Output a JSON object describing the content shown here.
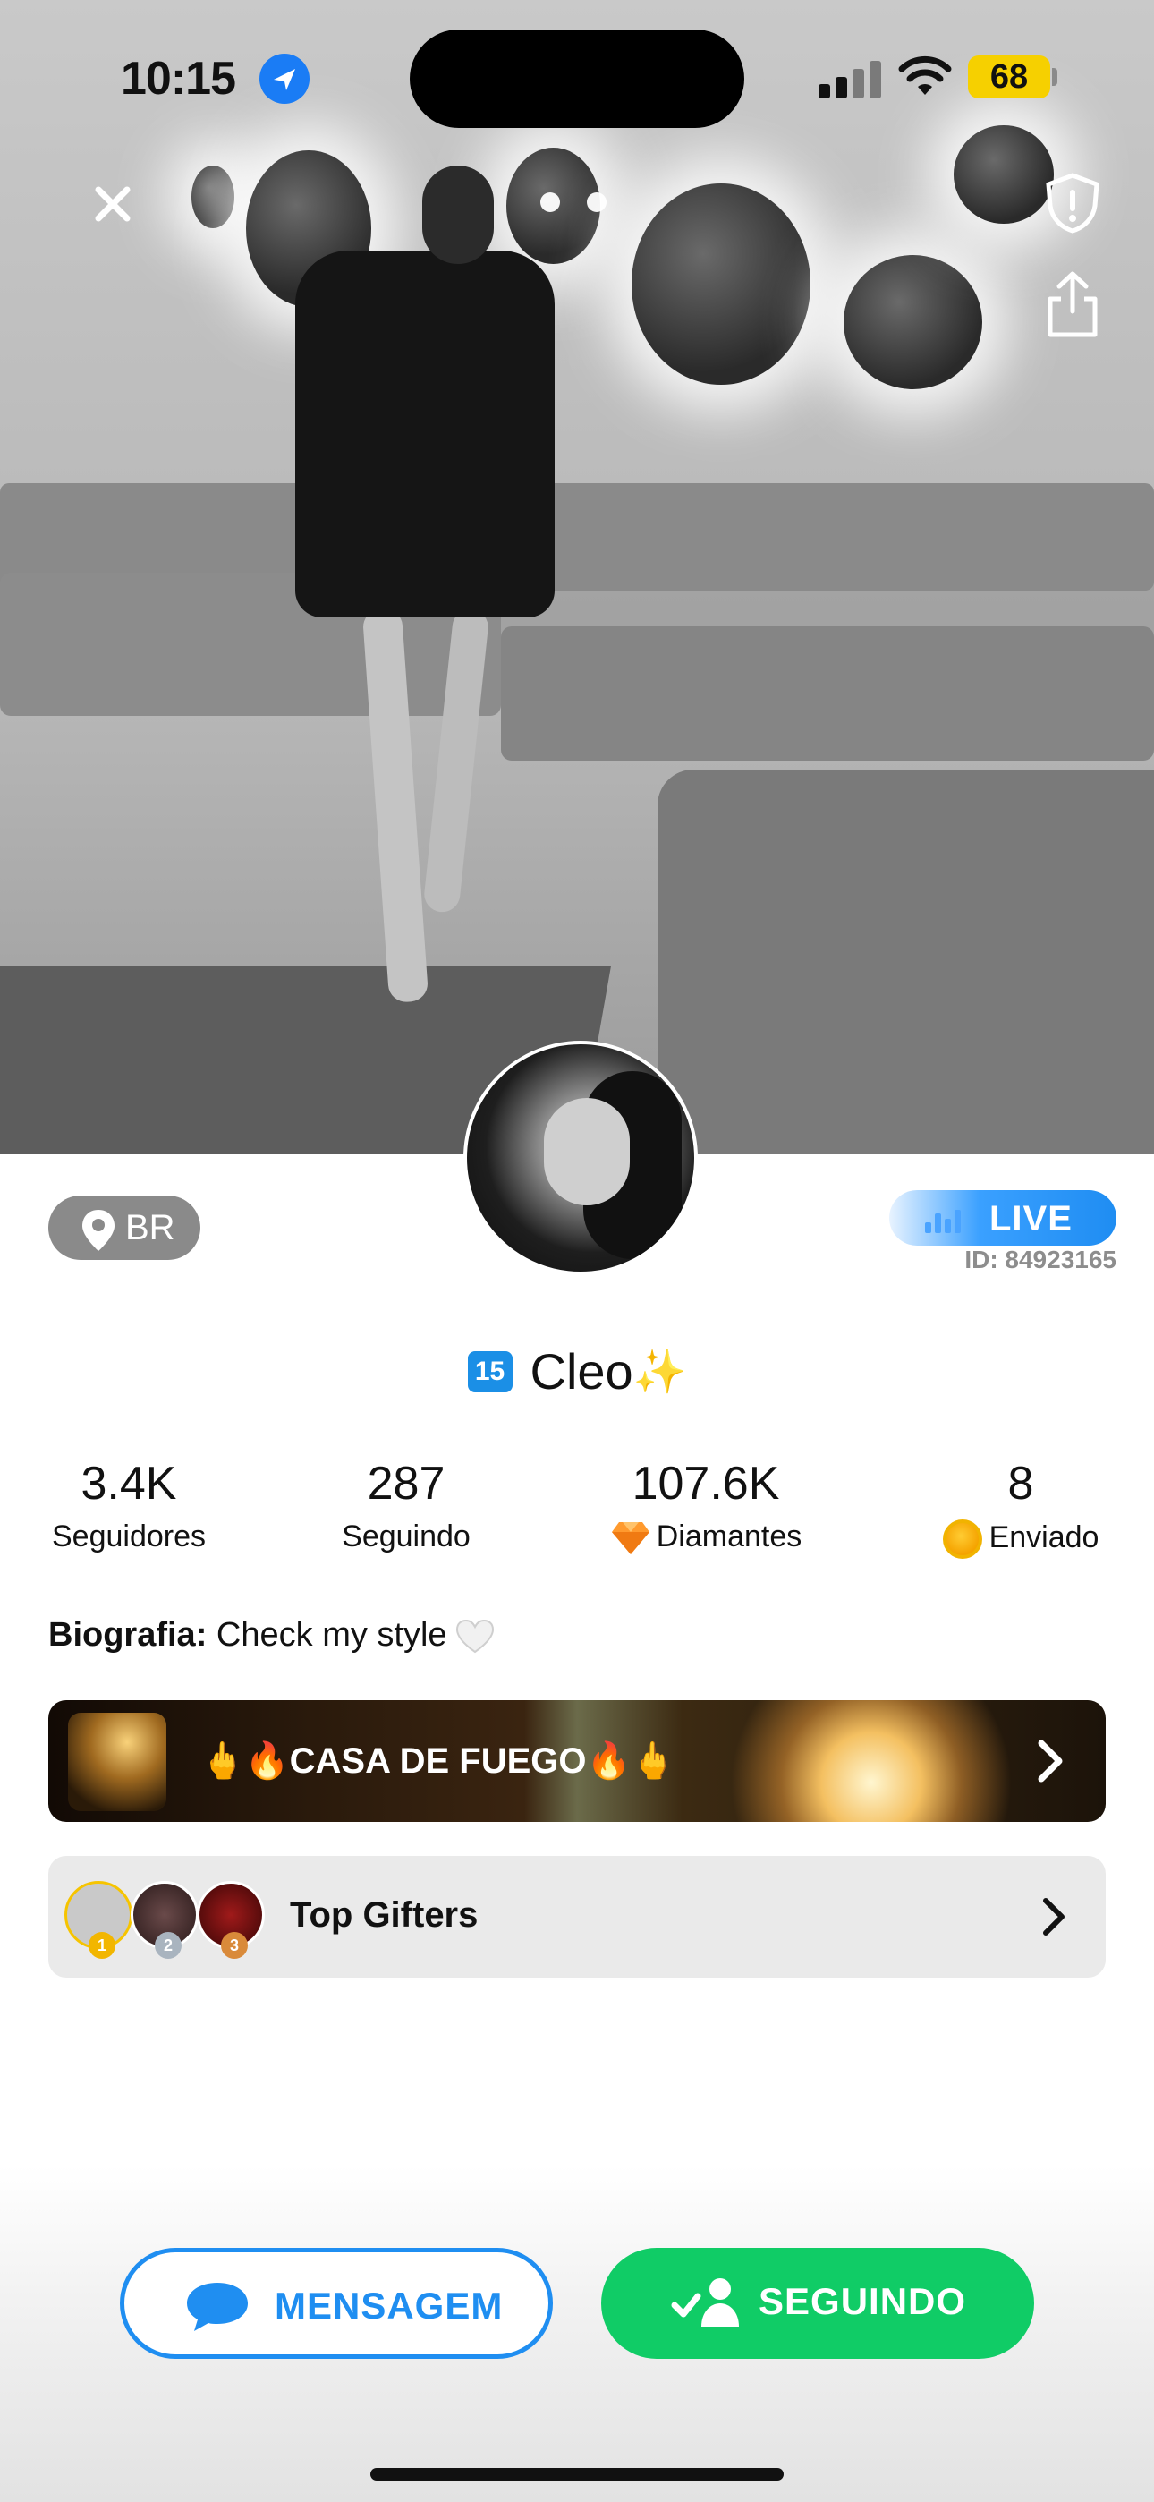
{
  "status_bar": {
    "time": "10:15",
    "battery": "68"
  },
  "profile": {
    "location": "BR",
    "live_label": "LIVE",
    "id_text": "ID: 84923165",
    "level": "15",
    "name": "Cleo",
    "name_emoji": "✨"
  },
  "stats": [
    {
      "value": "3.4K",
      "label": "Seguidores"
    },
    {
      "value": "287",
      "label": "Seguindo"
    },
    {
      "value": "107.6K",
      "label": "Diamantes",
      "icon": "diamond-icon"
    },
    {
      "value": "8",
      "label": "Enviado",
      "icon": "coin-icon"
    }
  ],
  "bio": {
    "label": "Biografia:",
    "text": "Check my style",
    "emoji": "white-heart-icon"
  },
  "banner": {
    "title": "🖕🔥CASA DE FUEGO🔥🖕"
  },
  "top_gifters": {
    "label": "Top Gifters",
    "medals": [
      "1",
      "2",
      "3"
    ]
  },
  "actions": {
    "message": "MENSAGEM",
    "following": "SEGUINDO"
  },
  "colors": {
    "accent_blue": "#1f8ef1",
    "follow_green": "#10cc66",
    "level_badge": "#1b8fe6"
  }
}
